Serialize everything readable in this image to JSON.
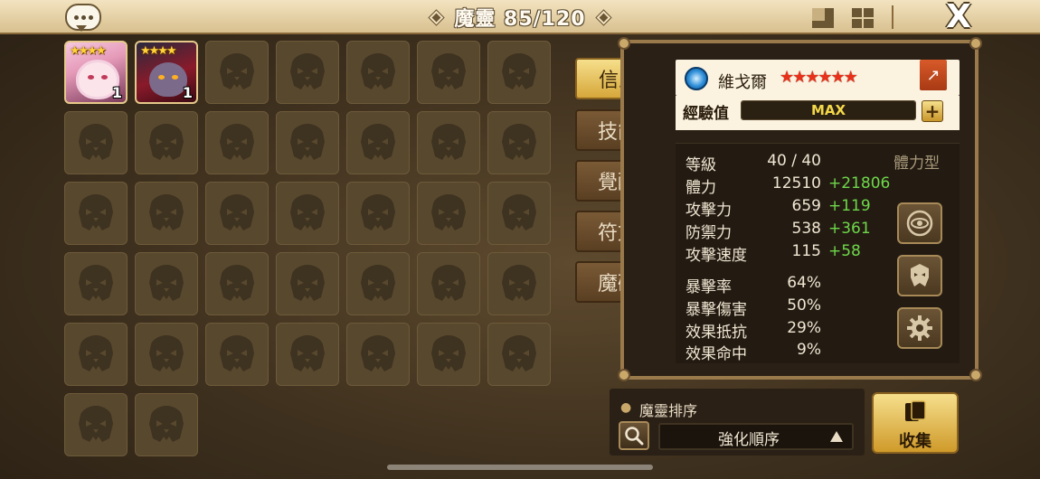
{
  "header": {
    "title": "魔靈 85/120",
    "close_glyph": "X"
  },
  "monster_grid": {
    "owned": [
      {
        "name": "monster-1",
        "stars": "★★★★",
        "level": "1"
      },
      {
        "name": "monster-2",
        "stars": "★★★★",
        "level": "1"
      }
    ],
    "empty_slot_icon": "monster-silhouette-icon"
  },
  "tabs": [
    {
      "label": "信息",
      "active": true
    },
    {
      "label": "技能",
      "active": false
    },
    {
      "label": "覺醒",
      "active": false
    },
    {
      "label": "符文",
      "active": false
    },
    {
      "label": "魔礦",
      "active": false
    }
  ],
  "monster": {
    "element_icon": "water-element-icon",
    "name": "維戈爾",
    "stars": "★★★★★★",
    "exp_label": "經驗值",
    "exp_value": "MAX",
    "exp_progress": 1.0,
    "type": "體力型"
  },
  "stats": [
    {
      "label": "等級",
      "value": "40 / 40",
      "bonus": ""
    },
    {
      "label": "體力",
      "value": "12510",
      "bonus": "+21806"
    },
    {
      "label": "攻擊力",
      "value": "659",
      "bonus": "+119"
    },
    {
      "label": "防禦力",
      "value": "538",
      "bonus": "+361"
    },
    {
      "label": "攻擊速度",
      "value": "115",
      "bonus": "+58"
    },
    {
      "label": "暴擊率",
      "value": "64%",
      "bonus": ""
    },
    {
      "label": "暴擊傷害",
      "value": "50%",
      "bonus": ""
    },
    {
      "label": "效果抵抗",
      "value": "29%",
      "bonus": ""
    },
    {
      "label": "效果命中",
      "value": "9%",
      "bonus": ""
    }
  ],
  "sort": {
    "title": "魔靈排序",
    "value": "強化順序"
  },
  "collect": {
    "label": "收集"
  },
  "colors": {
    "bonus_green": "#6ed84a",
    "gold": "#d6a73a",
    "exp_text": "#f3d84a"
  }
}
